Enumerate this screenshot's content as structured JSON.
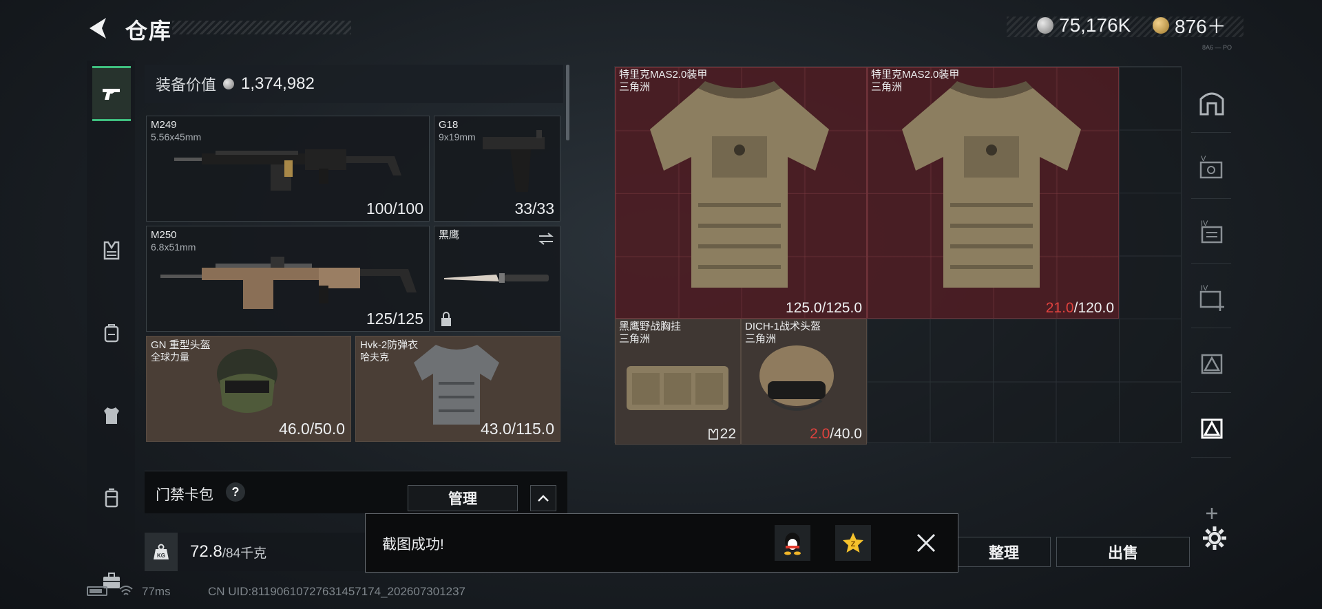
{
  "header": {
    "title": "仓库",
    "currency_silver": "75,176K",
    "currency_gold": "876＋",
    "tiny_text": "8A6 — PO"
  },
  "left_nav": {
    "items": [
      "weapons",
      "chest-rig",
      "backpack",
      "armor",
      "container",
      "case"
    ]
  },
  "equipment": {
    "value_label": "装备价值",
    "value": "1,374,982",
    "slots": [
      {
        "name": "M249",
        "sub": "5.56x45mm",
        "durability": "100/100"
      },
      {
        "name": "G18",
        "sub": "9x19mm",
        "durability": "33/33"
      },
      {
        "name": "M250",
        "sub": "6.8x51mm",
        "durability": "125/125"
      },
      {
        "name": "黑鹰",
        "sub": "",
        "durability": ""
      },
      {
        "name": "GN 重型头盔",
        "sub": "全球力量",
        "durability": "46.0/50.0"
      },
      {
        "name": "Hvk-2防弹衣",
        "sub": "哈夫克",
        "durability": "43.0/115.0"
      }
    ]
  },
  "card_pack": {
    "label": "门禁卡包",
    "help": "?",
    "manage_label": "管理"
  },
  "weight": {
    "icon_text": "KG",
    "current": "72.8",
    "capacity": "/84千克"
  },
  "status_bar": {
    "ping": "77ms",
    "uid": "CN UID:8119061072763145717​4_202607301237"
  },
  "stash": {
    "items": [
      {
        "name": "特里克MAS2.0装甲",
        "sub": "三角洲",
        "dur_current": "125.0",
        "dur_max": "/125.0",
        "low": false
      },
      {
        "name": "特里克MAS2.0装甲",
        "sub": "三角洲",
        "dur_current": "21.0",
        "dur_max": "/120.0",
        "low": true
      },
      {
        "name": "黑鹰野战胸挂",
        "sub": "三角洲",
        "count": "22"
      },
      {
        "name": "DICH-1战术头盔",
        "sub": "三角洲",
        "dur_current": "2.0",
        "dur_max": "/40.0",
        "low": true
      }
    ]
  },
  "buttons": {
    "sort": "整理",
    "sell": "出售"
  },
  "toast": {
    "message": "截图成功!"
  },
  "colors": {
    "accent_green": "#3fbf7f",
    "low_durability_red": "#e0423e",
    "item_red_bg": "#581e24",
    "item_tan_bg": "#4a3e36"
  }
}
